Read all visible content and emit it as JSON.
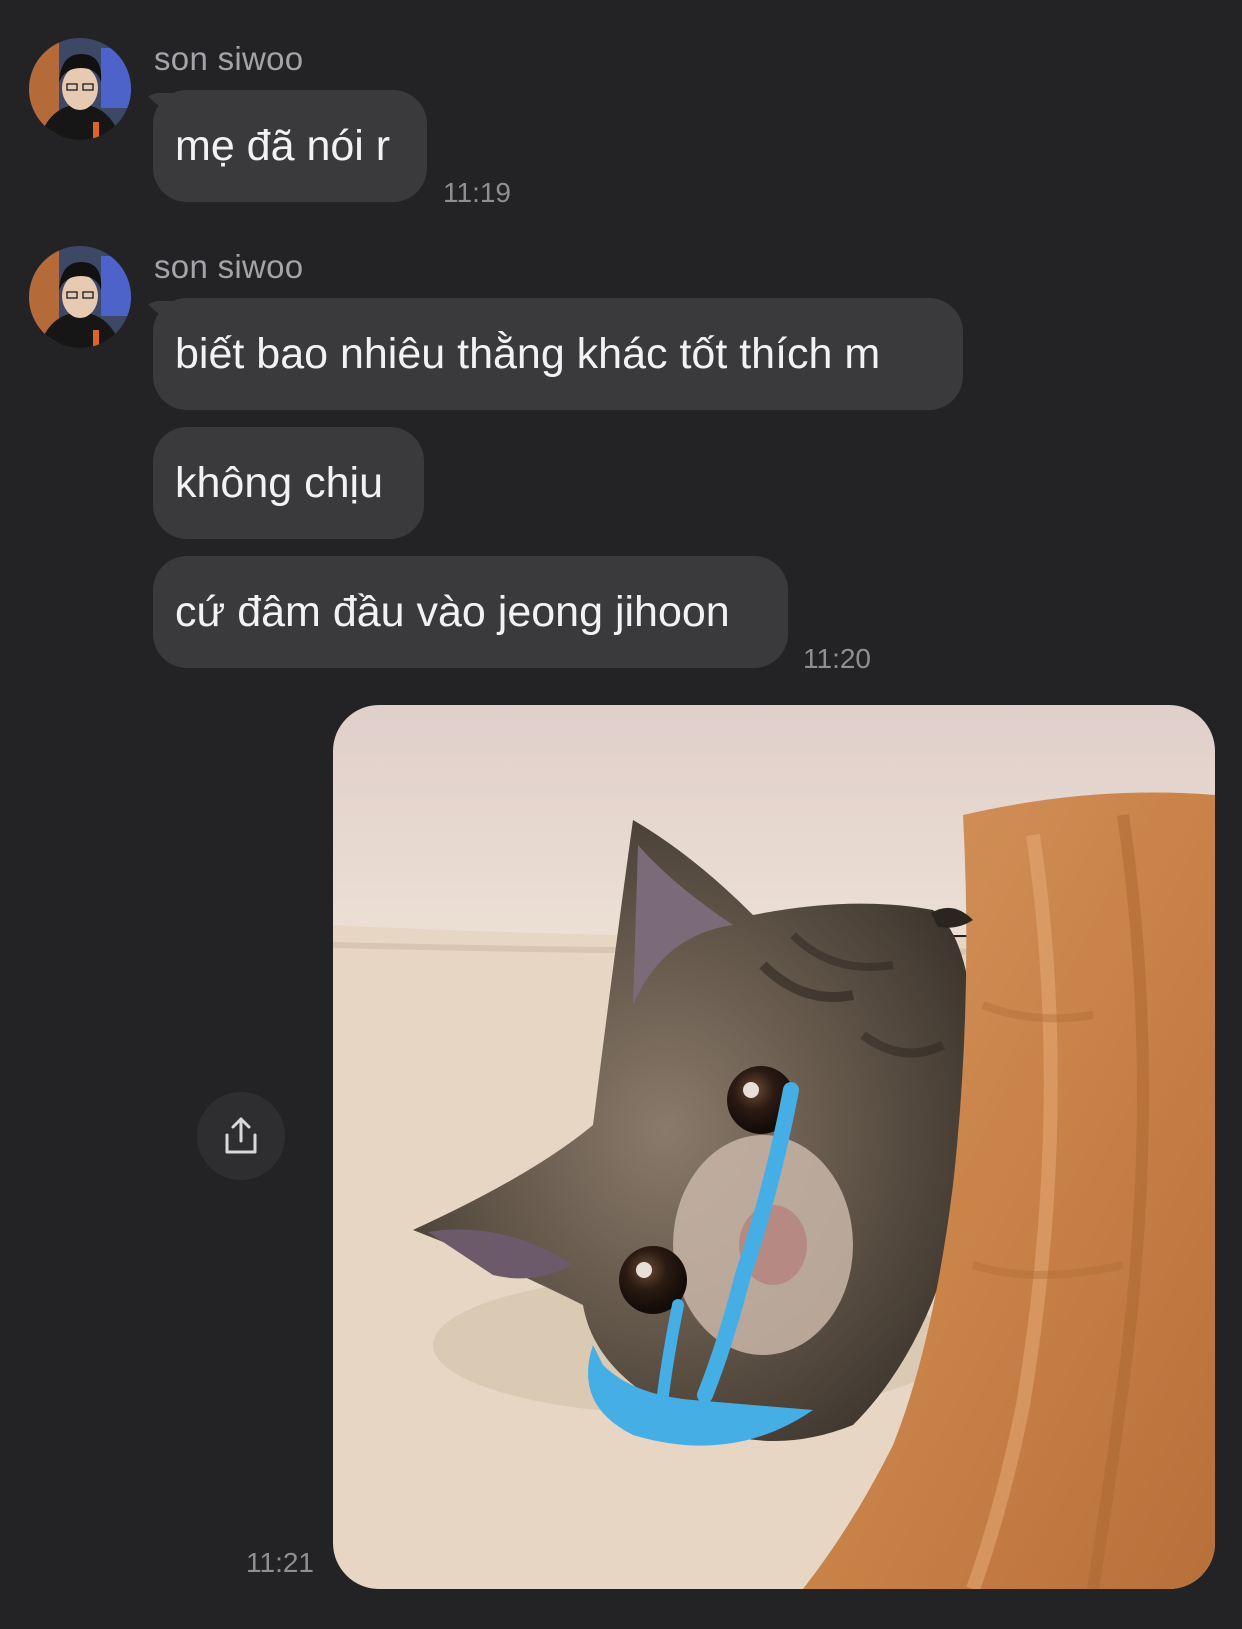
{
  "messages": [
    {
      "sender": "son siwoo",
      "bubbles": [
        "mẹ đã nói r"
      ],
      "time": "11:19"
    },
    {
      "sender": "son siwoo",
      "bubbles": [
        "biết bao nhiêu thằng khác tốt thích m",
        "không chịu",
        "cứ đâm đầu vào jeong jihoon"
      ],
      "time": "11:20"
    }
  ],
  "sent_photo": {
    "time": "11:21",
    "share_icon": "share-icon"
  },
  "colors": {
    "background": "#232325",
    "bubble": "#3a3a3c",
    "text": "#f2f2f4",
    "muted": "#8e8e93",
    "tear": "#45aee5"
  }
}
